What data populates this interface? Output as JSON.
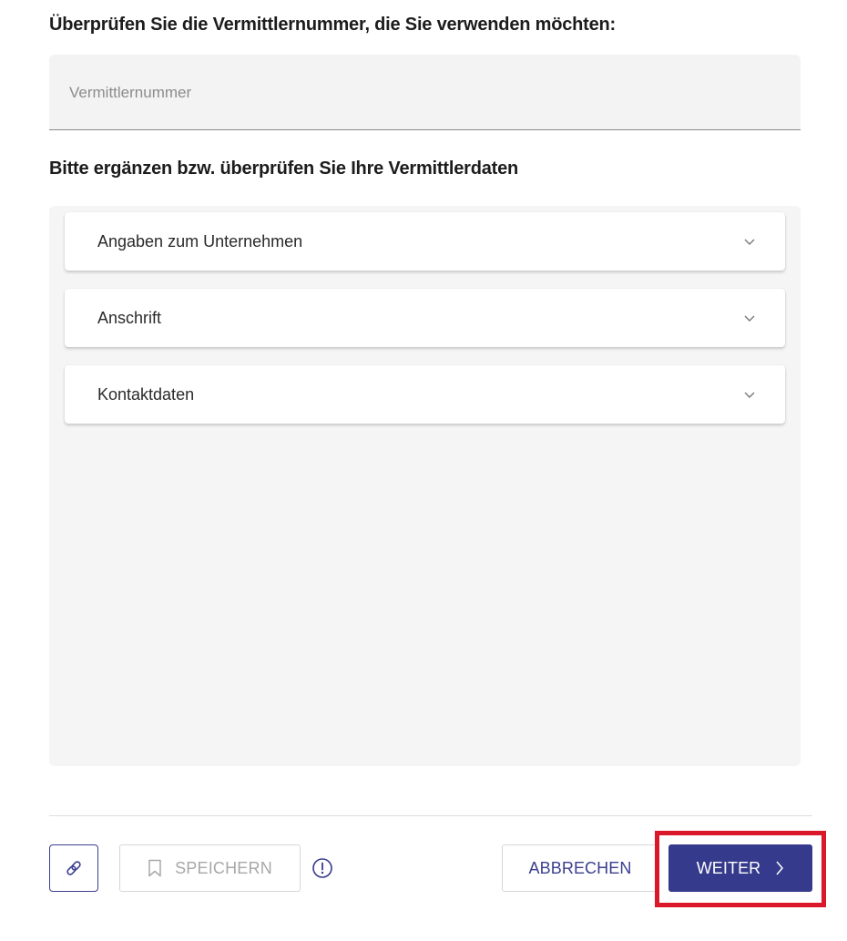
{
  "broker_number": {
    "label": "Überprüfen Sie die Vermittlernummer, die Sie verwenden möchten:",
    "placeholder": "Vermittlernummer",
    "value": ""
  },
  "broker_data": {
    "label": "Bitte ergänzen bzw. überprüfen Sie Ihre Vermittlerdaten",
    "sections": [
      {
        "label": "Angaben zum Unternehmen",
        "icon": "chevron-down-icon",
        "expanded": false
      },
      {
        "label": "Anschrift",
        "icon": "chevron-down-icon",
        "expanded": false
      },
      {
        "label": "Kontaktdaten",
        "icon": "chevron-down-icon",
        "expanded": false
      }
    ]
  },
  "footer": {
    "link_icon": "link-icon",
    "save_label": "SPEICHERN",
    "save_icon": "bookmark-icon",
    "save_enabled": false,
    "info_icon": "info-icon",
    "cancel_label": "ABBRECHEN",
    "next_label": "WEITER",
    "next_icon": "chevron-right-icon"
  },
  "colors": {
    "primary": "#353a8c",
    "highlight": "#d9182a",
    "panel_background": "#f5f5f5",
    "disabled_text": "#a8a8a8"
  }
}
